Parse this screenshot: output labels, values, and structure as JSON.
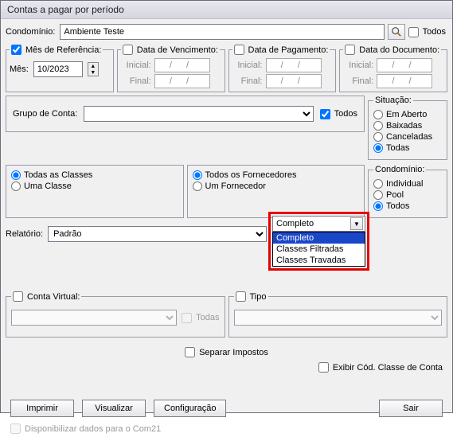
{
  "title": "Contas a pagar por período",
  "top": {
    "condominio_label": "Condomínio:",
    "condominio_value": "Ambiente Teste",
    "todos_label": "Todos"
  },
  "mes_ref": {
    "legend": "Mês de Referência:",
    "mes_label": "Mês:",
    "mes_value": "10/2023"
  },
  "data_venc": {
    "legend": "Data de Vencimento:",
    "inicial_label": "Inicial:",
    "final_label": "Final:",
    "inicial_value": "  /  /",
    "final_value": "  /  /"
  },
  "data_pag": {
    "legend": "Data de Pagamento:",
    "inicial_label": "Inicial:",
    "final_label": "Final:",
    "inicial_value": "  /  /",
    "final_value": "  /  /"
  },
  "data_doc": {
    "legend": "Data do Documento:",
    "inicial_label": "Inicial:",
    "final_label": "Final:",
    "inicial_value": "  /  /",
    "final_value": "  /  /"
  },
  "grupo": {
    "label": "Grupo de Conta:",
    "todos_label": "Todos"
  },
  "situacao": {
    "legend": "Situação:",
    "em_aberto": "Em Aberto",
    "baixadas": "Baixadas",
    "canceladas": "Canceladas",
    "todas": "Todas"
  },
  "classes": {
    "todas": "Todas as Classes",
    "uma": "Uma Classe"
  },
  "fornecedores": {
    "todos": "Todos os Fornecedores",
    "um": "Um Fornecedor"
  },
  "condominio_box": {
    "legend": "Condomínio:",
    "individual": "Individual",
    "pool": "Pool",
    "todos": "Todos"
  },
  "relatorio": {
    "label": "Relatório:",
    "value": "Padrão",
    "dropdown_value": "Completo",
    "options": {
      "o1": "Completo",
      "o2": "Classes Filtradas",
      "o3": "Classes Travadas"
    }
  },
  "conta_virtual": {
    "legend": "Conta Virtual:",
    "todas_label": "Todas"
  },
  "tipo": {
    "legend": "Tipo"
  },
  "checks": {
    "separar": "Separar Impostos",
    "exibir": "Exibir Cód. Classe de Conta"
  },
  "buttons": {
    "imprimir": "Imprimir",
    "visualizar": "Visualizar",
    "config": "Configuração",
    "sair": "Sair"
  },
  "footer": {
    "com21": "Disponibilizar dados para o Com21"
  }
}
